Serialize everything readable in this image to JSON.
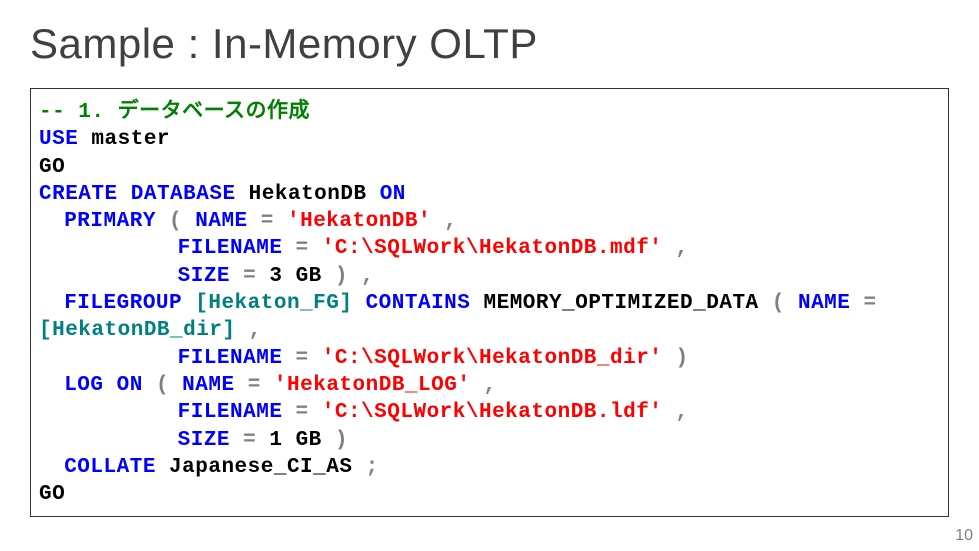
{
  "title": "Sample : In-Memory OLTP",
  "page_number": "10",
  "code": {
    "comment": "-- 1. データベースの作成",
    "use_kw": "USE",
    "use_arg": "master",
    "go1": "GO",
    "create_kw": "CREATE",
    "database_kw": "DATABASE",
    "db_name": "HekatonDB",
    "on_kw": "ON",
    "primary_kw": "PRIMARY",
    "open_paren1": " (",
    "name_kw1": "NAME ",
    "eq1": "=",
    "name_val1": " 'HekatonDB'",
    "comma1": ",",
    "filename_kw1": "FILENAME ",
    "eq2": "=",
    "filename_val1": " 'C:\\SQLWork\\HekatonDB.mdf'",
    "comma2": ",",
    "size_kw1": "SIZE ",
    "eq3": "=",
    "size_val1": " 3",
    "size_unit1": "GB",
    "close_paren1": " )",
    "comma3": ",",
    "filegroup_kw": "FILEGROUP",
    "fg_name": " [Hekaton_FG] ",
    "contains_kw": "CONTAINS",
    "mem_opt": " MEMORY_OPTIMIZED_DATA ",
    "open_paren2": "(",
    "name_kw2": "NAME ",
    "eq4": "=",
    "name_val2_pre": "[HekatonDB_dir]",
    "comma4": ",",
    "filename_kw2": "FILENAME ",
    "eq5": "=",
    "filename_val2": " 'C:\\SQLWork\\HekatonDB_dir'",
    "close_paren2": ")",
    "log_kw": "LOG",
    "on_kw2": "ON",
    "open_paren3": "  (",
    "name_kw3": "NAME ",
    "eq6": "=",
    "name_val3": " 'HekatonDB_LOG'",
    "comma5": ",",
    "filename_kw3": "FILENAME ",
    "eq7": "=",
    "filename_val3": " 'C:\\SQLWork\\HekatonDB.ldf'",
    "comma6": ",",
    "size_kw2": "SIZE ",
    "eq8": "=",
    "size_val2": " 1",
    "size_unit2": "GB",
    "close_paren3": ")",
    "collate_kw": "COLLATE",
    "collate_val": " Japanese_CI_AS",
    "semi": ";",
    "go2": "GO"
  }
}
